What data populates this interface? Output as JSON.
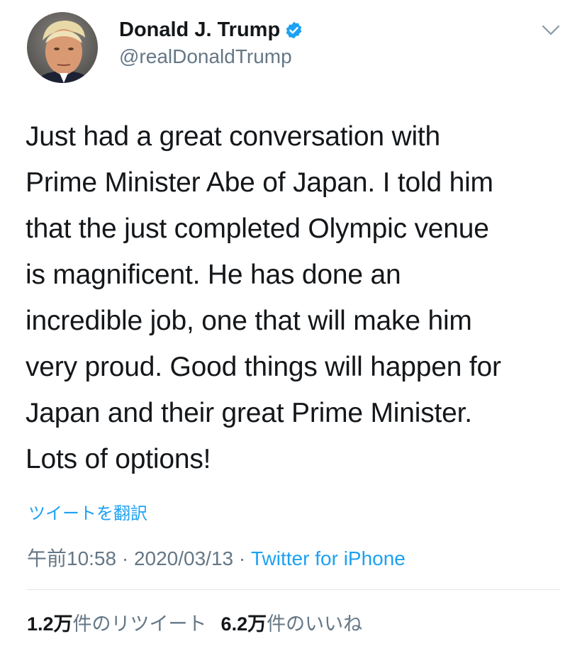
{
  "author": {
    "display_name": "Donald J. Trump",
    "handle": "@realDonaldTrump",
    "verified_icon": "verified-badge-icon",
    "avatar_icon": "profile-avatar"
  },
  "tweet": {
    "text": "Just had a great conversation with\nPrime Minister Abe of Japan. I told him\nthat the just completed Olympic venue\nis magnificent. He has done an\nincredible job, one that will make him\nvery proud. Good things will happen for\nJapan and their great Prime Minister.\nLots of options!",
    "translate_label": "ツイートを翻訳"
  },
  "meta": {
    "time": "午前10:58",
    "separator": " · ",
    "date": "2020/03/13",
    "source": "Twitter for iPhone"
  },
  "stats": {
    "retweets_count": "1.2万",
    "retweets_label": "件のリツイート",
    "likes_count": "6.2万",
    "likes_label": "件のいいね"
  },
  "colors": {
    "link": "#1da1f2",
    "secondary_text": "#657786",
    "primary_text": "#14171a",
    "divider": "#e1e8ed"
  }
}
